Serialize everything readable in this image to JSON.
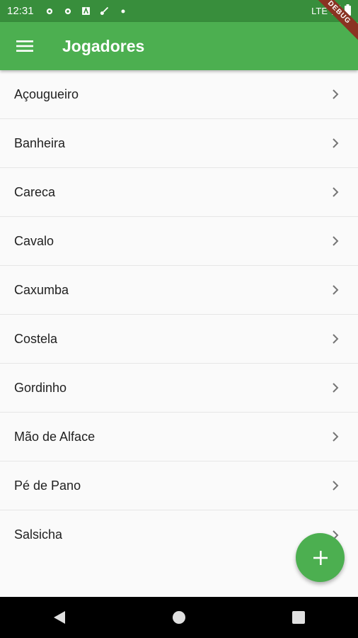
{
  "status_bar": {
    "time": "12:31",
    "network": "LTE"
  },
  "app_bar": {
    "title": "Jogadores",
    "menu_icon": "menu-icon"
  },
  "debug_banner": "DEBUG",
  "players": [
    "Açougueiro",
    "Banheira",
    "Careca",
    "Cavalo",
    "Caxumba",
    "Costela",
    "Gordinho",
    "Mão de Alface",
    "Pé de Pano",
    "Salsicha"
  ],
  "fab": {
    "icon": "add-icon"
  },
  "nav": {
    "back": "back-icon",
    "home": "home-icon",
    "recents": "recents-icon"
  },
  "colors": {
    "primary": "#4caf50",
    "status": "#388e3c"
  }
}
